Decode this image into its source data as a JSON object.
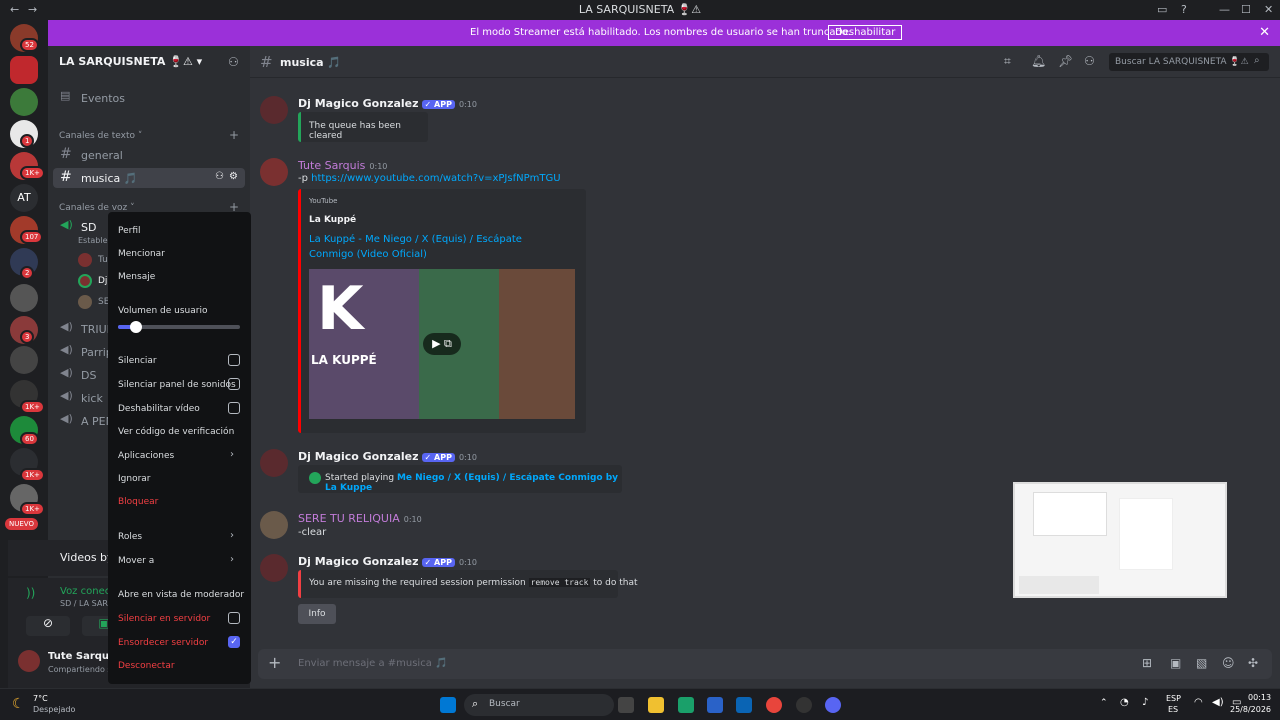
{
  "window": {
    "title": "LA SARQUISNETA 🍷⚠"
  },
  "banner": {
    "text": "El modo Streamer está habilitado. Los nombres de usuario se han truncado.",
    "button": "Deshabilitar"
  },
  "rail": {
    "badges": [
      "52",
      "1",
      "1K+",
      "107",
      "2",
      "3",
      "1K+",
      "1K+",
      "60",
      "1K+",
      "1K+"
    ],
    "at": "AT",
    "new": "NUEVO"
  },
  "server": {
    "name": "LA SARQUISNETA 🍷⚠"
  },
  "sidebar": {
    "events": "Eventos",
    "text_category": "Canales de texto",
    "text_channels": [
      "general",
      "musica 🎵"
    ],
    "voice_category": "Canales de voz",
    "voice_channels": [
      "SD",
      "TRIUN",
      "Parrip",
      "DS",
      "kick",
      "A PEN"
    ],
    "voice_sub": "Establec",
    "voice_users": [
      "Tu",
      "Dj",
      "SE"
    ],
    "activity": "Videos by Tute",
    "voice_status": "Voz conectada",
    "voice_location": "SD / LA SARQUISN",
    "user_name": "Tute Sarquis",
    "user_status": "Compartiendo s"
  },
  "header": {
    "channel": "musica 🎵",
    "search_placeholder": "Buscar LA SARQUISNETA 🍷⚠"
  },
  "messages": [
    {
      "author": "Dj Magico Gonzalez",
      "badge": "✓ APP",
      "time": "0:10",
      "embed": "The queue has been cleared"
    },
    {
      "author": "Tute Sarquis",
      "time": "0:10",
      "prefix": "-p ",
      "link": "https://www.youtube.com/watch?v=xPJsfNPmTGU",
      "embed_provider": "YouTube",
      "embed_author": "La Kuppé",
      "embed_title": "La Kuppé - Me Niego / X (Equis) / Escápate Conmigo (Video Oficial)",
      "embed_logo": "LA KUPPÉ"
    },
    {
      "author": "Dj Magico Gonzalez",
      "badge": "✓ APP",
      "time": "0:10",
      "playing_prefix": "Started playing ",
      "playing_track": "Me Niego / X (Equis) / Escápate Conmigo by La Kuppe"
    },
    {
      "author": "SERE TU RELIQUIA",
      "time": "0:10",
      "text": "-clear"
    },
    {
      "author": "Dj Magico Gonzalez",
      "badge": "✓ APP",
      "time": "0:10",
      "error_prefix": "You are missing the required session permission ",
      "error_code": "remove track",
      "error_suffix": " to do that",
      "button": "Info"
    }
  ],
  "composer": {
    "placeholder": "Enviar mensaje a #musica 🎵"
  },
  "context_menu": {
    "profile": "Perfil",
    "mention": "Mencionar",
    "message": "Mensaje",
    "volume_label": "Volumen de usuario",
    "volume_level": 0.15,
    "mute": "Silenciar",
    "mute_soundboard": "Silenciar panel de sonidos",
    "disable_video": "Deshabilitar vídeo",
    "verify_code": "Ver código de verificación",
    "apps": "Aplicaciones",
    "ignore": "Ignorar",
    "block": "Bloquear",
    "roles": "Roles",
    "move_to": "Mover a",
    "mod_view": "Abre en vista de moderador",
    "server_mute": "Silenciar en servidor",
    "server_deafen": "Ensordecer servidor",
    "disconnect": "Desconectar"
  },
  "taskbar": {
    "weather_temp": "7°C",
    "weather_desc": "Despejado",
    "search": "Buscar",
    "lang1": "ESP",
    "lang2": "ES",
    "time": "00:13",
    "date": "25/8/2026"
  },
  "colors": {
    "accent": "#5865f2",
    "banner": "#9b30d9",
    "danger": "#f23f43",
    "link": "#00a8fc"
  }
}
